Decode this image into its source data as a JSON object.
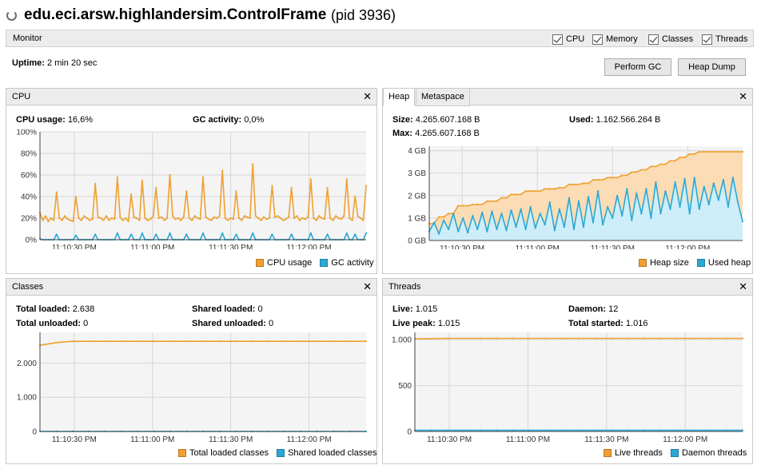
{
  "window": {
    "title": "edu.eci.arsw.highlandersim.ControlFrame",
    "pid": "(pid 3936)"
  },
  "monitor": {
    "label": "Monitor",
    "checkboxes": [
      {
        "label": "CPU",
        "checked": true
      },
      {
        "label": "Memory",
        "checked": true
      },
      {
        "label": "Classes",
        "checked": true
      },
      {
        "label": "Threads",
        "checked": true
      }
    ],
    "uptime_label": "Uptime:",
    "uptime_value": "2 min 20 sec",
    "perform_gc": "Perform GC",
    "heap_dump": "Heap Dump"
  },
  "colors": {
    "orange": "#f0a030",
    "blue": "#2aa8d6",
    "orange_fill": "#fbdcb4",
    "blue_fill": "#cdeef9",
    "plot_bg": "#f4f4f4",
    "grid": "#d6d6d6"
  },
  "cpu": {
    "title": "CPU",
    "cpu_usage_label": "CPU usage:",
    "cpu_usage_value": "16,6%",
    "gc_activity_label": "GC activity:",
    "gc_activity_value": "0,0%",
    "legend": [
      "CPU usage",
      "GC activity"
    ]
  },
  "heap": {
    "tabs": [
      "Heap",
      "Metaspace"
    ],
    "size_label": "Size:",
    "size_value": "4.265.607.168 B",
    "max_label": "Max:",
    "max_value": "4.265.607.168 B",
    "used_label": "Used:",
    "used_value": "1.162.566.264 B",
    "legend": [
      "Heap size",
      "Used heap"
    ]
  },
  "classes": {
    "title": "Classes",
    "total_loaded_label": "Total loaded:",
    "total_loaded_value": "2.638",
    "total_unloaded_label": "Total unloaded:",
    "total_unloaded_value": "0",
    "shared_loaded_label": "Shared loaded:",
    "shared_loaded_value": "0",
    "shared_unloaded_label": "Shared unloaded:",
    "shared_unloaded_value": "0",
    "legend": [
      "Total loaded classes",
      "Shared loaded classes"
    ]
  },
  "threads": {
    "title": "Threads",
    "live_label": "Live:",
    "live_value": "1.015",
    "live_peak_label": "Live peak:",
    "live_peak_value": "1.015",
    "daemon_label": "Daemon:",
    "daemon_value": "12",
    "total_started_label": "Total started:",
    "total_started_value": "1.016",
    "legend": [
      "Live threads",
      "Daemon threads"
    ]
  },
  "chart_data": [
    {
      "id": "cpu",
      "type": "line",
      "x_ticks": [
        "11:10:30 PM",
        "11:11:00 PM",
        "11:11:30 PM",
        "11:12:00 PM"
      ],
      "y_ticks": [
        "0%",
        "20%",
        "40%",
        "60%",
        "80%",
        "100%"
      ],
      "ylim": [
        0,
        100
      ],
      "series": [
        {
          "name": "CPU usage",
          "color": "#f0a030",
          "values": [
            25,
            18,
            22,
            17,
            20,
            18,
            44,
            20,
            18,
            22,
            19,
            18,
            17,
            40,
            20,
            18,
            22,
            20,
            18,
            19,
            52,
            21,
            20,
            18,
            22,
            18,
            20,
            19,
            58,
            21,
            18,
            20,
            17,
            42,
            21,
            20,
            18,
            55,
            20,
            18,
            19,
            22,
            48,
            20,
            21,
            18,
            20,
            60,
            22,
            19,
            20,
            18,
            21,
            45,
            20,
            18,
            22,
            20,
            19,
            58,
            21,
            19,
            18,
            21,
            20,
            22,
            64,
            20,
            18,
            20,
            19,
            45,
            20,
            18,
            22,
            21,
            20,
            70,
            22,
            20,
            18,
            21,
            19,
            20,
            50,
            21,
            22,
            20,
            18,
            19,
            21,
            48,
            20,
            22,
            18,
            20,
            19,
            21,
            56,
            20,
            18,
            22,
            20,
            19,
            48,
            20,
            18,
            22,
            20,
            19,
            22,
            56,
            20,
            18,
            40,
            22,
            20,
            18,
            50
          ]
        },
        {
          "name": "GC activity",
          "color": "#2aa8d6",
          "values": [
            1,
            0,
            0,
            0,
            0,
            0,
            5,
            0,
            0,
            0,
            0,
            0,
            0,
            4,
            0,
            0,
            0,
            0,
            0,
            0,
            5,
            0,
            0,
            0,
            0,
            0,
            0,
            0,
            6,
            0,
            0,
            0,
            0,
            5,
            0,
            0,
            0,
            6,
            0,
            0,
            0,
            0,
            5,
            0,
            0,
            0,
            0,
            6,
            0,
            0,
            0,
            0,
            0,
            5,
            0,
            0,
            0,
            0,
            0,
            6,
            0,
            0,
            0,
            0,
            0,
            0,
            6,
            0,
            0,
            0,
            0,
            5,
            0,
            0,
            0,
            0,
            0,
            6,
            0,
            0,
            0,
            0,
            0,
            0,
            5,
            0,
            0,
            0,
            0,
            0,
            0,
            5,
            0,
            0,
            0,
            0,
            0,
            0,
            6,
            0,
            0,
            0,
            0,
            0,
            5,
            0,
            0,
            0,
            0,
            0,
            0,
            6,
            0,
            0,
            5,
            0,
            0,
            0,
            6
          ]
        }
      ]
    },
    {
      "id": "heap",
      "type": "area",
      "x_ticks": [
        "11:10:30 PM",
        "11:11:00 PM",
        "11:11:30 PM",
        "11:12:00 PM"
      ],
      "y_ticks": [
        "0 GB",
        "1 GB",
        "2 GB",
        "3 GB",
        "4 GB"
      ],
      "ylim": [
        0,
        4.2
      ],
      "series": [
        {
          "name": "Heap size",
          "color": "#f0a030",
          "values": [
            0.75,
            0.75,
            1.05,
            1.05,
            1.2,
            1.2,
            1.55,
            1.55,
            1.55,
            1.6,
            1.6,
            1.6,
            1.75,
            1.75,
            1.75,
            1.9,
            1.9,
            2.05,
            2.05,
            2.05,
            2.2,
            2.2,
            2.2,
            2.2,
            2.3,
            2.3,
            2.3,
            2.35,
            2.35,
            2.5,
            2.5,
            2.5,
            2.55,
            2.55,
            2.7,
            2.7,
            2.7,
            2.8,
            2.8,
            2.8,
            2.9,
            2.9,
            3.05,
            3.05,
            3.15,
            3.15,
            3.3,
            3.3,
            3.4,
            3.4,
            3.55,
            3.55,
            3.7,
            3.7,
            3.85,
            3.85,
            3.95,
            3.95,
            3.95,
            3.95,
            3.95,
            3.95,
            3.95,
            3.95,
            3.95,
            3.95
          ]
        },
        {
          "name": "Used heap",
          "color": "#2aa8d6",
          "values": [
            0.4,
            0.8,
            0.3,
            0.9,
            0.5,
            1.2,
            0.4,
            1.0,
            0.35,
            1.1,
            0.5,
            1.25,
            0.4,
            1.3,
            0.5,
            1.2,
            0.45,
            1.35,
            0.6,
            1.4,
            0.5,
            1.5,
            0.55,
            1.2,
            0.7,
            1.7,
            0.45,
            1.4,
            0.6,
            1.9,
            0.5,
            1.75,
            0.6,
            1.95,
            0.8,
            2.2,
            0.7,
            1.5,
            1.0,
            2.0,
            1.1,
            2.3,
            0.9,
            2.1,
            1.2,
            2.3,
            1.0,
            2.6,
            1.2,
            2.2,
            1.4,
            2.6,
            1.5,
            2.75,
            1.2,
            2.8,
            1.4,
            2.4,
            1.6,
            2.55,
            1.8,
            2.7,
            1.5,
            2.8,
            1.7,
            0.85
          ]
        }
      ]
    },
    {
      "id": "classes",
      "type": "line",
      "x_ticks": [
        "11:10:30 PM",
        "11:11:00 PM",
        "11:11:30 PM",
        "11:12:00 PM"
      ],
      "y_ticks": [
        "0",
        "1.000",
        "2.000"
      ],
      "ylim": [
        0,
        2900
      ],
      "series": [
        {
          "name": "Total loaded classes",
          "color": "#f0a030",
          "values": [
            2520,
            2600,
            2638,
            2638,
            2638,
            2638,
            2638,
            2638,
            2638,
            2638,
            2638,
            2638,
            2638,
            2638,
            2638,
            2638,
            2638,
            2638,
            2638,
            2638,
            2638
          ]
        },
        {
          "name": "Shared loaded classes",
          "color": "#2aa8d6",
          "values": [
            0,
            0,
            0,
            0,
            0,
            0,
            0,
            0,
            0,
            0,
            0,
            0,
            0,
            0,
            0,
            0,
            0,
            0,
            0,
            0,
            0
          ]
        }
      ]
    },
    {
      "id": "threads",
      "type": "line",
      "x_ticks": [
        "11:10:30 PM",
        "11:11:00 PM",
        "11:11:30 PM",
        "11:12:00 PM"
      ],
      "y_ticks": [
        "0",
        "500",
        "1.000"
      ],
      "ylim": [
        0,
        1080
      ],
      "series": [
        {
          "name": "Live threads",
          "color": "#f0a030",
          "values": [
            1010,
            1012,
            1015,
            1015,
            1015,
            1015,
            1015,
            1015,
            1015,
            1015,
            1015,
            1015,
            1015,
            1015,
            1015,
            1015,
            1015,
            1015,
            1015,
            1015,
            1015
          ]
        },
        {
          "name": "Daemon threads",
          "color": "#2aa8d6",
          "values": [
            12,
            12,
            12,
            12,
            12,
            12,
            12,
            12,
            12,
            12,
            12,
            12,
            12,
            12,
            12,
            12,
            12,
            12,
            12,
            12,
            12
          ]
        }
      ]
    }
  ]
}
